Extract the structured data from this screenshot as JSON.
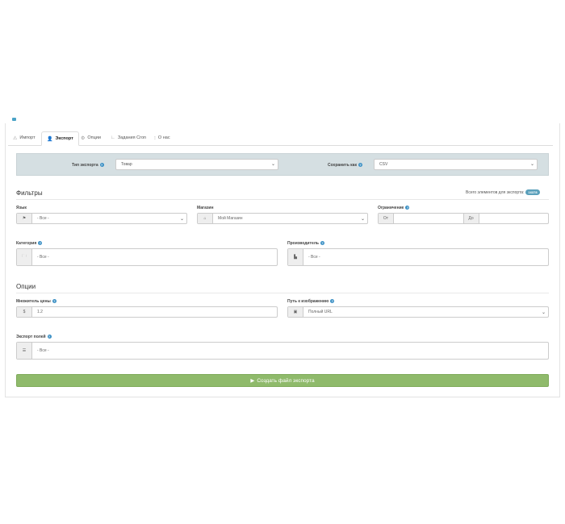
{
  "tabs": [
    {
      "label": "Импорт",
      "icon": "import-icon"
    },
    {
      "label": "Экспорт",
      "icon": "user-icon"
    },
    {
      "label": "Опции",
      "icon": "gear-icon"
    },
    {
      "label": "Задания Cron",
      "icon": "cron-icon"
    },
    {
      "label": "О нас",
      "icon": "info-icon"
    }
  ],
  "export_bar": {
    "type_label": "Тип экспорта",
    "type_value": "Товар",
    "save_label": "Сохранить как",
    "save_value": "CSV"
  },
  "filters": {
    "title": "Фильтры",
    "total_label": "Всего элементов для экспорта:",
    "total_badge": "16378",
    "language_label": "Язык",
    "language_value": "- Все -",
    "store_label": "Магазин",
    "store_value": "Мой Магазин",
    "limit_label": "Ограничение",
    "limit_from": "От",
    "limit_to": "До",
    "category_label": "Категория",
    "category_value": "- Все -",
    "manufacturer_label": "Производитель",
    "manufacturer_value": "- Все -"
  },
  "options": {
    "title": "Опции",
    "price_label": "Множитель цены",
    "price_addon": "$",
    "price_value": "1.2",
    "image_label": "Путь к изображению",
    "image_value": "Полный URL",
    "fields_label": "Экспорт полей",
    "fields_value": "- Все -"
  },
  "generate_button": "Создать файл экспорта",
  "colors": {
    "accent": "#3a8fc4",
    "button": "#8fba6b",
    "bar": "#d5dfe2"
  }
}
